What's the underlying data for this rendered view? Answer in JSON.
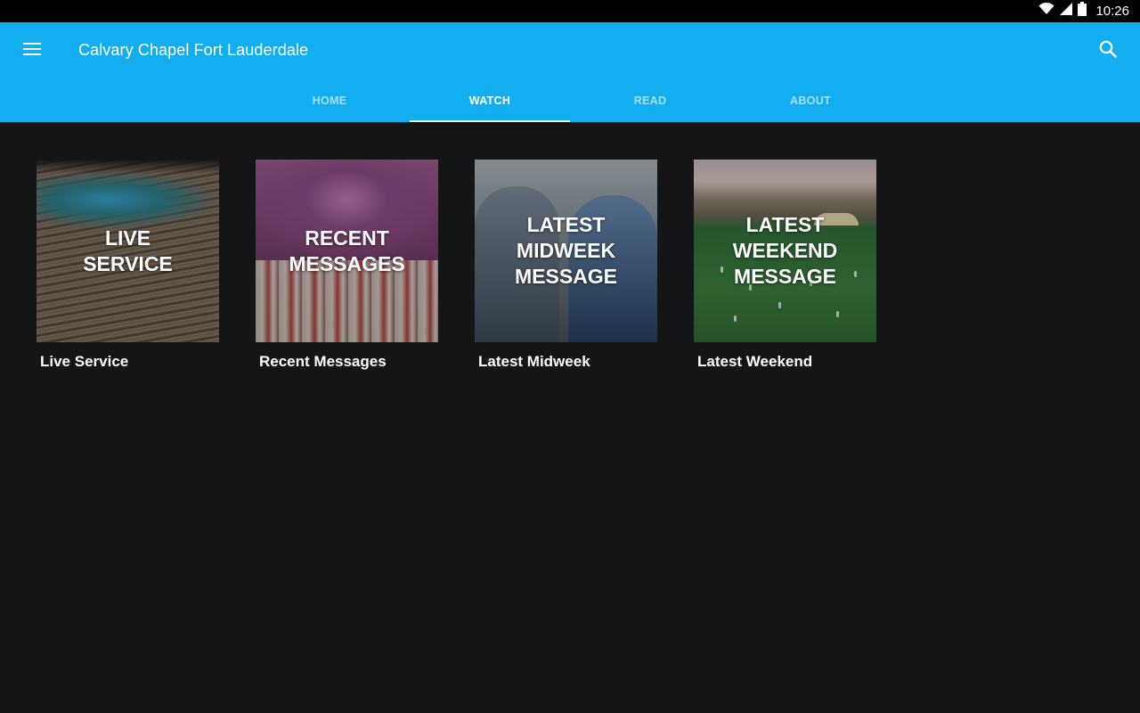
{
  "status_bar": {
    "time": "10:26",
    "icons": [
      "wifi-icon",
      "signal-icon",
      "battery-icon"
    ]
  },
  "app_bar": {
    "title": "Calvary Chapel Fort Lauderdale",
    "background_color": "#12aeef",
    "menu_icon": "hamburger-menu-icon",
    "search_icon": "search-icon"
  },
  "tabs": [
    {
      "label": "HOME",
      "active": false
    },
    {
      "label": "WATCH",
      "active": true
    },
    {
      "label": "READ",
      "active": false
    },
    {
      "label": "ABOUT",
      "active": false
    }
  ],
  "cards": [
    {
      "thumb_text": "LIVE\nSERVICE",
      "label": "Live Service"
    },
    {
      "thumb_text": "RECENT\nMESSAGES",
      "label": "Recent Messages"
    },
    {
      "thumb_text": "LATEST\nMIDWEEK\nMESSAGE",
      "label": "Latest Midweek"
    },
    {
      "thumb_text": "LATEST\nWEEKEND\nMESSAGE",
      "label": "Latest Weekend"
    }
  ]
}
